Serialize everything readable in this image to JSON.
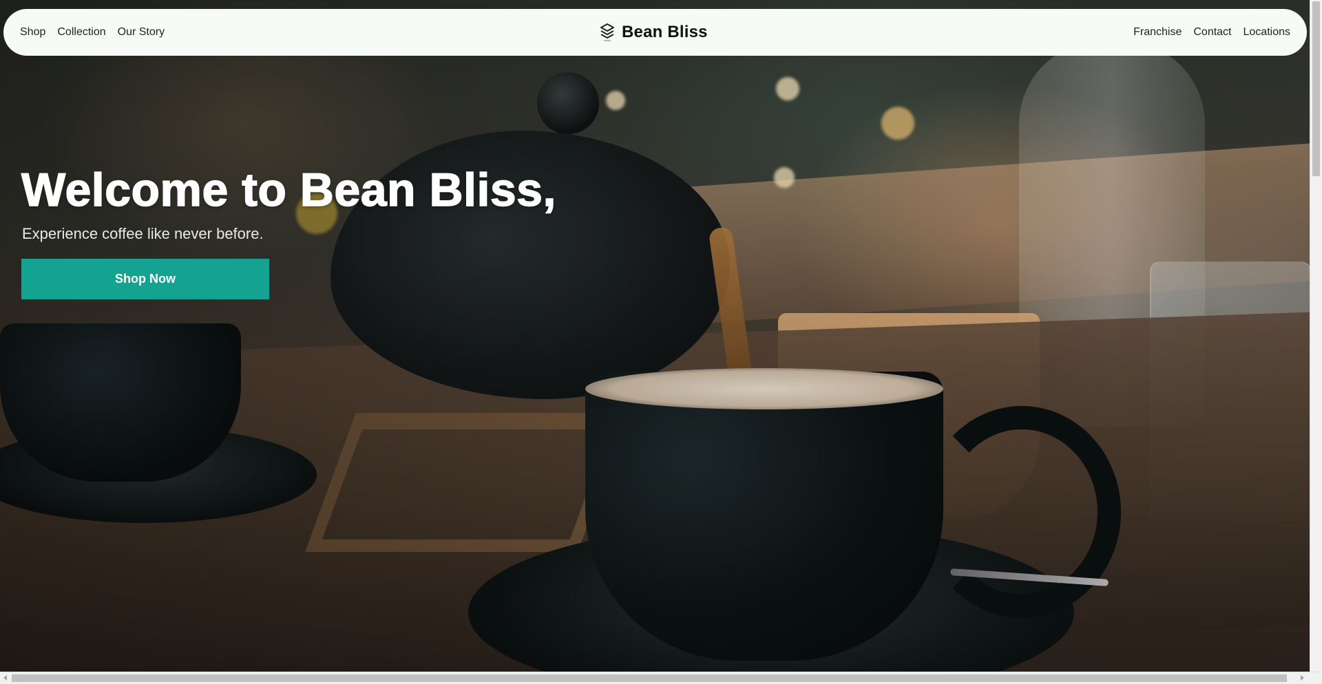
{
  "nav": {
    "left_items": [
      {
        "label": "Shop"
      },
      {
        "label": "Collection"
      },
      {
        "label": "Our Story"
      }
    ],
    "brand": {
      "name": "Bean Bliss",
      "icon": "layers-icon"
    },
    "right_items": [
      {
        "label": "Franchise"
      },
      {
        "label": "Contact"
      },
      {
        "label": "Locations"
      }
    ],
    "background": "#f6fbf8"
  },
  "hero": {
    "title": "Welcome to Bean Bliss,",
    "subtitle": "Experience coffee like never before.",
    "cta_label": "Shop Now",
    "cta_color": "#14a291"
  }
}
